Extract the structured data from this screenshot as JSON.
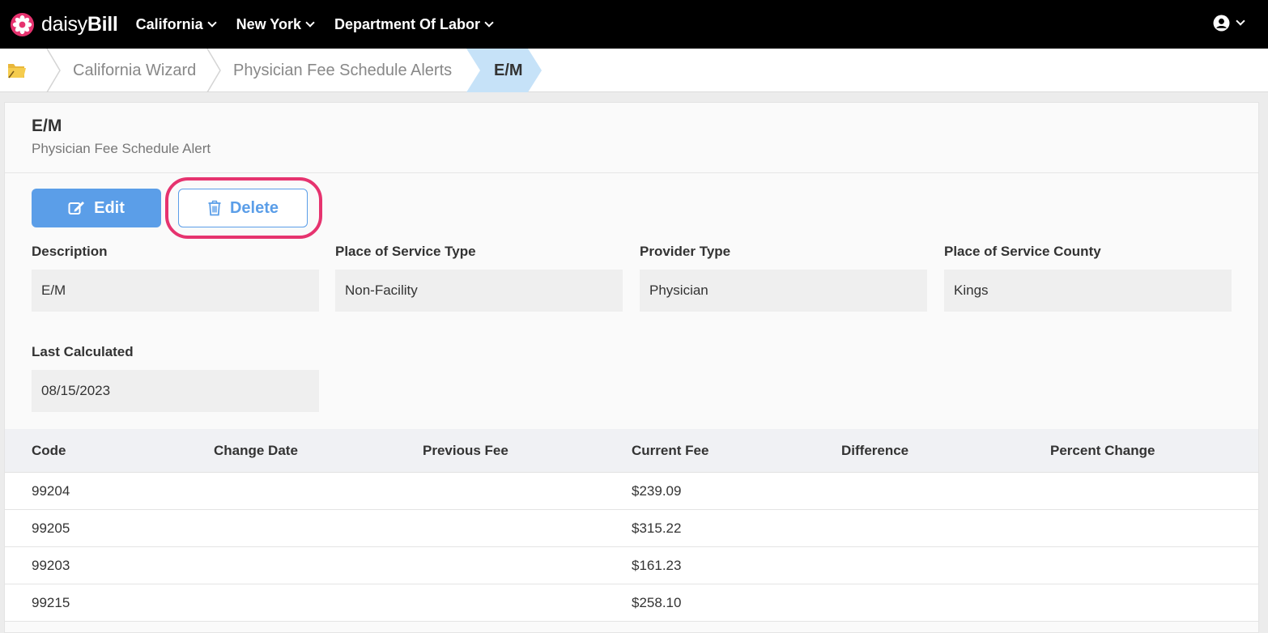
{
  "app": {
    "logo_light": "daisy",
    "logo_bold": "Bill"
  },
  "nav": {
    "items": [
      {
        "label": "California"
      },
      {
        "label": "New York"
      },
      {
        "label": "Department Of Labor"
      }
    ]
  },
  "breadcrumb": {
    "items": [
      "California Wizard",
      "Physician Fee Schedule Alerts",
      "E/M"
    ]
  },
  "page": {
    "title": "E/M",
    "subtitle": "Physician Fee Schedule Alert",
    "edit_label": "Edit",
    "delete_label": "Delete"
  },
  "fields": {
    "description": {
      "label": "Description",
      "value": "E/M"
    },
    "place_of_service_type": {
      "label": "Place of Service Type",
      "value": "Non-Facility"
    },
    "provider_type": {
      "label": "Provider Type",
      "value": "Physician"
    },
    "place_of_service_county": {
      "label": "Place of Service County",
      "value": "Kings"
    },
    "last_calculated": {
      "label": "Last Calculated",
      "value": "08/15/2023"
    }
  },
  "table": {
    "headers": [
      "Code",
      "Change Date",
      "Previous Fee",
      "Current Fee",
      "Difference",
      "Percent Change"
    ],
    "rows": [
      [
        "99204",
        "",
        "",
        "$239.09",
        "",
        ""
      ],
      [
        "99205",
        "",
        "",
        "$315.22",
        "",
        ""
      ],
      [
        "99203",
        "",
        "",
        "$161.23",
        "",
        ""
      ],
      [
        "99215",
        "",
        "",
        "$258.10",
        "",
        ""
      ]
    ]
  },
  "colors": {
    "accent": "#5b9ee8",
    "highlight": "#e6336f",
    "active_crumb": "#c6e2f8"
  }
}
